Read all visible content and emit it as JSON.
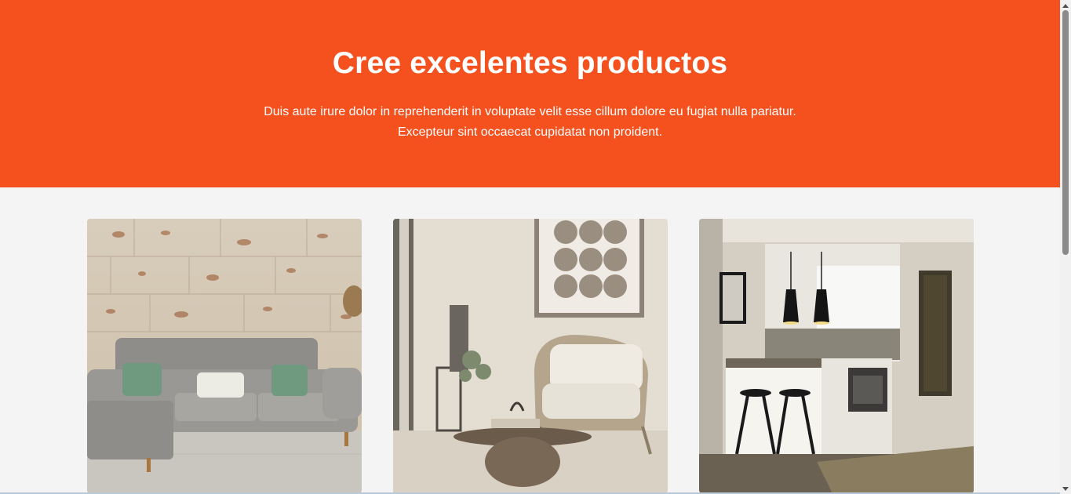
{
  "hero": {
    "title": "Cree excelentes productos",
    "lead_line1": "Duis aute irure dolor in reprehenderit in voluptate velit esse cillum dolore eu fugiat nulla pariatur.",
    "lead_line2": "Excepteur sint occaecat cupidatat non proident."
  },
  "cards": [
    {
      "image": "living-room-gray-sofa-photo"
    },
    {
      "image": "armchair-lounge-photo"
    },
    {
      "image": "kitchen-bar-photo"
    }
  ],
  "colors": {
    "hero_background": "#f4511e",
    "page_background": "#f4f4f4",
    "text_on_hero": "#ffffff"
  }
}
